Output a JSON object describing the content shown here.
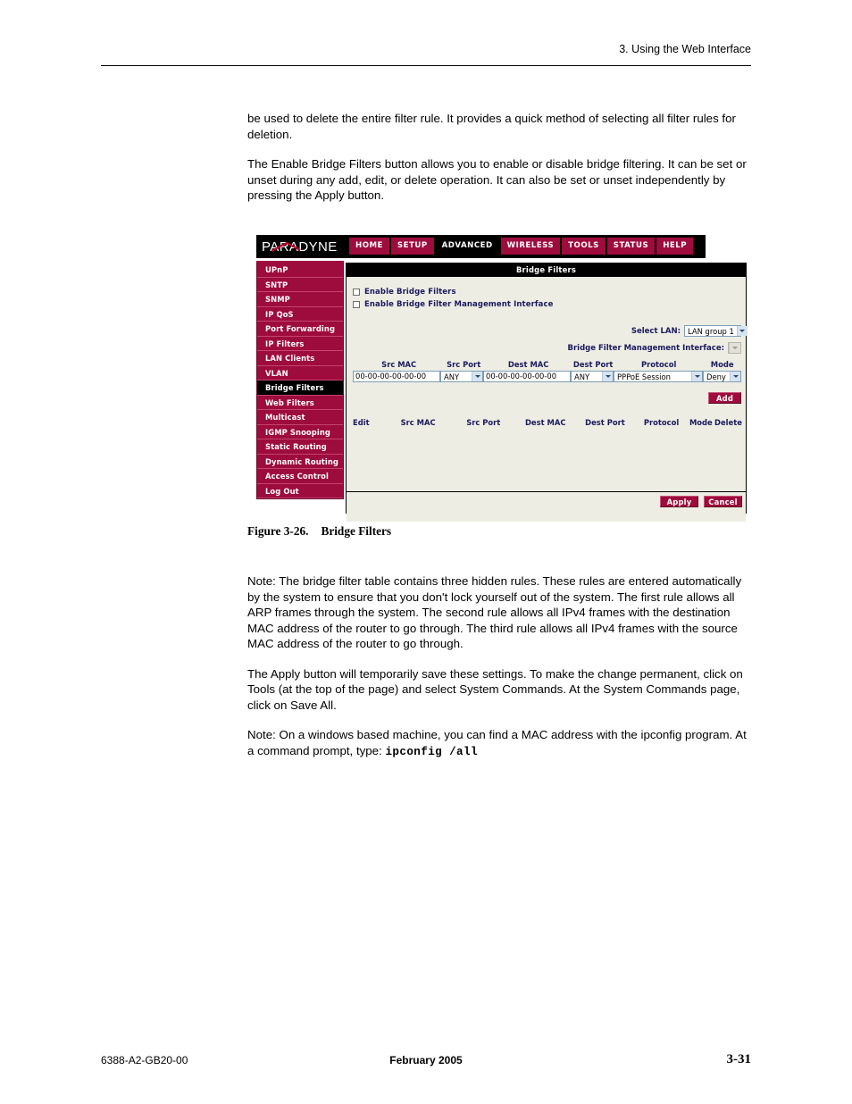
{
  "page": {
    "header_right": "3. Using the Web Interface",
    "footer_left": "6388-A2-GB20-00",
    "footer_center": "February 2005",
    "footer_right": "3-31"
  },
  "body": {
    "para1": "be used to delete the entire filter rule. It provides a quick method of selecting all filter rules for deletion.",
    "para2": "The Enable Bridge Filters button allows you to enable or disable bridge filtering. It can be set or unset during any add, edit, or delete operation. It can also be set or unset independently by pressing the Apply button.",
    "note1": "Note: The bridge filter table contains three hidden rules. These rules are entered automatically by the system to ensure that you don't lock yourself out of the system. The first rule allows all ARP frames through the system. The second rule allows all IPv4 frames with the destination MAC address of the router to go through. The third rule allows all IPv4 frames with the source MAC address of the router to go through.",
    "para3": "The Apply button will temporarily save these settings. To make the change permanent, click on Tools (at the top of the page) and select System Commands. At the System Commands page, click on Save All.",
    "note2_prefix": "Note: On a windows based machine, you can find a MAC address with the ipconfig program. At a command prompt, type: ",
    "note2_code": "ipconfig /all"
  },
  "figure": {
    "number": "Figure 3-26.",
    "title": "Bridge Filters"
  },
  "screenshot": {
    "logo_text": "PARADYNE",
    "nav": [
      {
        "label": "HOME",
        "active": false
      },
      {
        "label": "SETUP",
        "active": false
      },
      {
        "label": "ADVANCED",
        "active": true
      },
      {
        "label": "WIRELESS",
        "active": false
      },
      {
        "label": "TOOLS",
        "active": false
      },
      {
        "label": "STATUS",
        "active": false
      },
      {
        "label": "HELP",
        "active": false
      }
    ],
    "sidebar": [
      {
        "label": "UPnP",
        "active": false
      },
      {
        "label": "SNTP",
        "active": false
      },
      {
        "label": "SNMP",
        "active": false
      },
      {
        "label": "IP QoS",
        "active": false
      },
      {
        "label": "Port Forwarding",
        "active": false
      },
      {
        "label": "IP Filters",
        "active": false
      },
      {
        "label": "LAN Clients",
        "active": false
      },
      {
        "label": "VLAN",
        "active": false
      },
      {
        "label": "Bridge Filters",
        "active": true
      },
      {
        "label": "Web Filters",
        "active": false
      },
      {
        "label": "Multicast",
        "active": false
      },
      {
        "label": "IGMP Snooping",
        "active": false
      },
      {
        "label": "Static Routing",
        "active": false
      },
      {
        "label": "Dynamic Routing",
        "active": false
      },
      {
        "label": "Access Control",
        "active": false
      },
      {
        "label": "Log Out",
        "active": false
      }
    ],
    "panel_title": "Bridge Filters",
    "checkboxes": [
      {
        "label": "Enable Bridge Filters",
        "checked": false
      },
      {
        "label": "Enable Bridge Filter Management Interface",
        "checked": false
      }
    ],
    "select_lan": {
      "label": "Select LAN:",
      "value": "LAN group 1"
    },
    "mgmt_interface": {
      "label": "Bridge Filter Management Interface:",
      "value": "",
      "disabled": true
    },
    "entry_form": {
      "headers": [
        "Src MAC",
        "Src Port",
        "Dest MAC",
        "Dest Port",
        "Protocol",
        "Mode"
      ],
      "src_mac": "00-00-00-00-00-00",
      "src_port": "ANY",
      "dest_mac": "00-00-00-00-00-00",
      "dest_port": "ANY",
      "protocol": "PPPoE Session",
      "mode": "Deny",
      "add_label": "Add"
    },
    "results_table": {
      "headers": [
        "Edit",
        "Src MAC",
        "Src Port",
        "Dest MAC",
        "Dest Port",
        "Protocol",
        "Mode",
        "Delete"
      ],
      "rows": []
    },
    "footer_buttons": {
      "apply": "Apply",
      "cancel": "Cancel"
    },
    "colors": {
      "brand_red": "#9e0b3d",
      "panel_bg": "#eeede4",
      "label_blue": "#1a1a5e",
      "black": "#000000"
    }
  }
}
